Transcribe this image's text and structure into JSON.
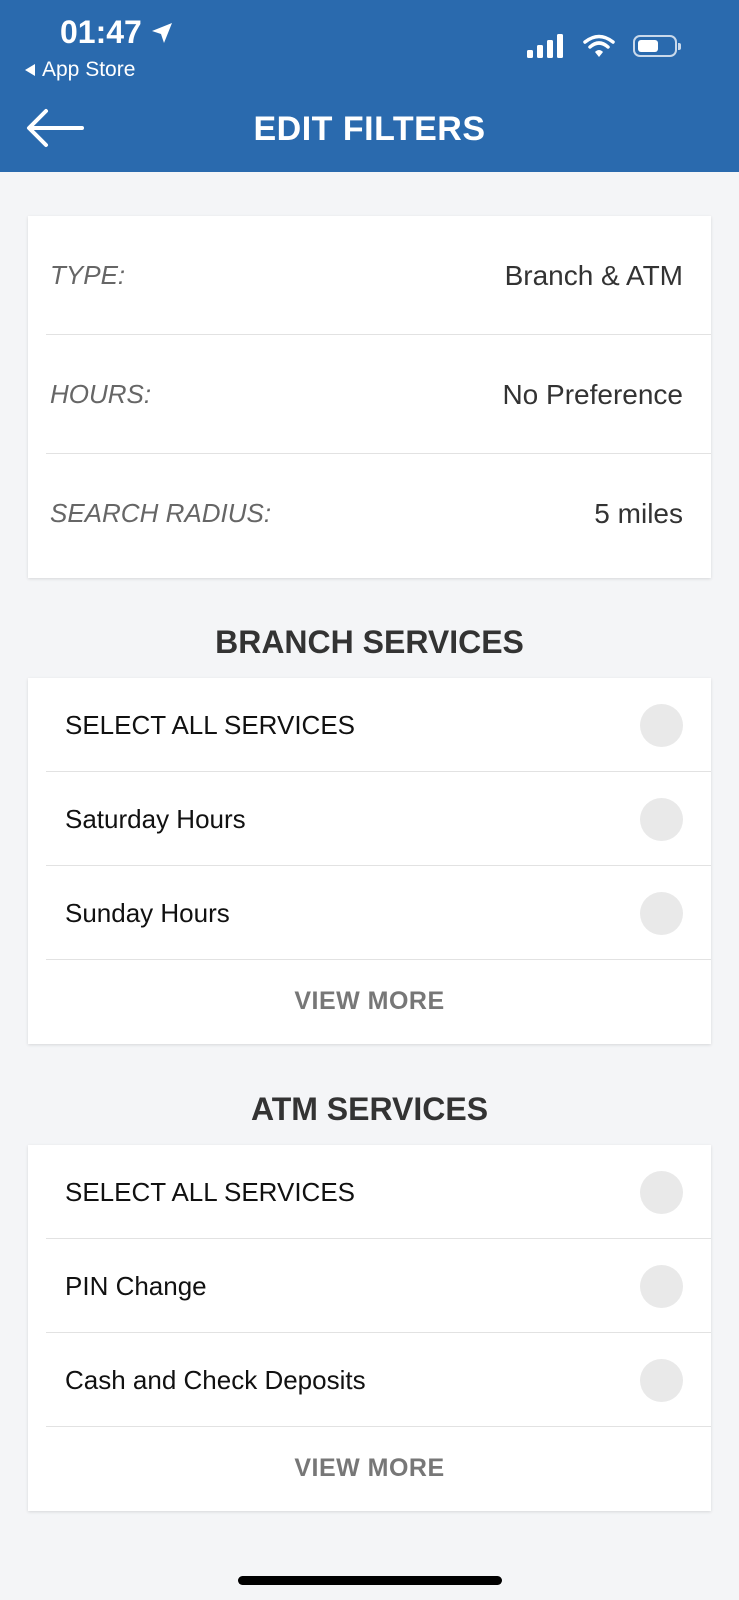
{
  "status_bar": {
    "time": "01:47",
    "back_app": "App Store"
  },
  "header": {
    "title": "EDIT FILTERS"
  },
  "filters": [
    {
      "label": "TYPE:",
      "value": "Branch & ATM"
    },
    {
      "label": "HOURS:",
      "value": "No Preference"
    },
    {
      "label": "SEARCH RADIUS:",
      "value": "5 miles"
    }
  ],
  "branch_services": {
    "title": "BRANCH SERVICES",
    "items": [
      {
        "label": "SELECT ALL SERVICES"
      },
      {
        "label": "Saturday Hours"
      },
      {
        "label": "Sunday Hours"
      }
    ],
    "view_more": "VIEW MORE"
  },
  "atm_services": {
    "title": "ATM SERVICES",
    "items": [
      {
        "label": "SELECT ALL SERVICES"
      },
      {
        "label": "PIN Change"
      },
      {
        "label": "Cash and Check Deposits"
      }
    ],
    "view_more": "VIEW MORE"
  },
  "colors": {
    "header_bg": "#2a6aae",
    "page_bg": "#f4f5f7",
    "toggle_off": "#e9e9e9"
  },
  "battery_level": 0.6
}
